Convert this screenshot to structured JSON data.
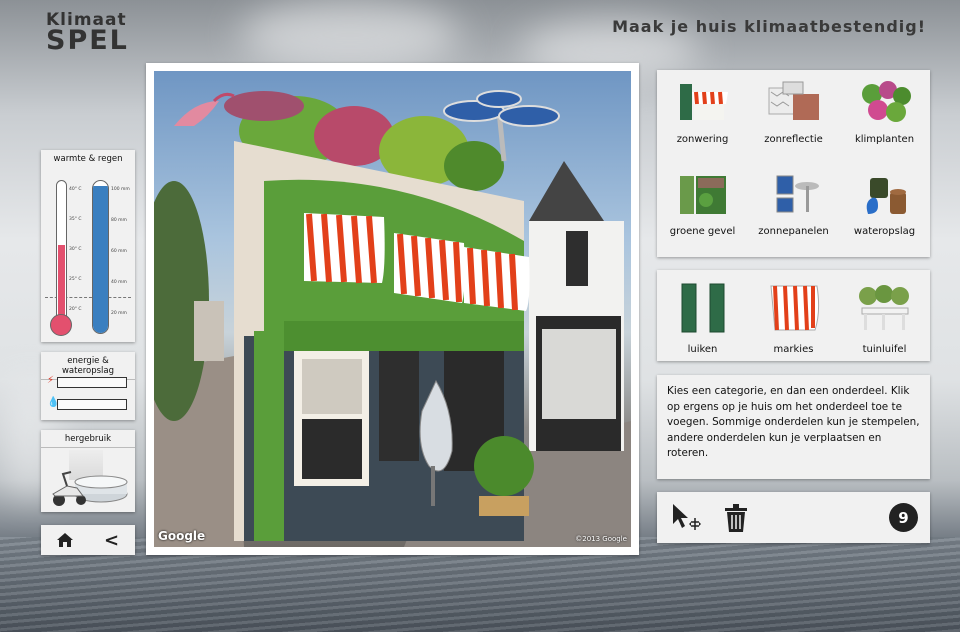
{
  "logo": {
    "line1": "Klimaat",
    "line2": "SPEL"
  },
  "headline": "Maak je huis klimaatbestendig!",
  "weather": {
    "title": "warmte & regen",
    "temp_ticks": [
      "40° C",
      "35° C",
      "30° C",
      "25° C",
      "20° C"
    ],
    "rain_ticks": [
      "100 mm",
      "80 mm",
      "60 mm",
      "40 mm",
      "20 mm"
    ],
    "temp_level": 0.55,
    "rain_level": 0.97
  },
  "energy": {
    "title": "energie & wateropslag",
    "energy_level": 0,
    "water_level": 0
  },
  "reuse": {
    "title": "hergebruik"
  },
  "nav": {
    "home_icon": "home-icon",
    "back_icon": "back-chevron-icon",
    "back_glyph": "<"
  },
  "viewport": {
    "watermark_left": "Google",
    "watermark_right": "©2013 Google"
  },
  "categories": [
    {
      "label": "zonwering",
      "icon": "awning-shade-icon"
    },
    {
      "label": "zonreflectie",
      "icon": "sun-reflection-icon"
    },
    {
      "label": "klimplanten",
      "icon": "climbing-plants-icon"
    },
    {
      "label": "groene gevel",
      "icon": "green-facade-icon"
    },
    {
      "label": "zonnepanelen",
      "icon": "solar-panels-icon"
    },
    {
      "label": "wateropslag",
      "icon": "water-storage-icon"
    }
  ],
  "parts": [
    {
      "label": "luiken",
      "icon": "shutters-icon"
    },
    {
      "label": "markies",
      "icon": "marquee-awning-icon"
    },
    {
      "label": "tuinluifel",
      "icon": "garden-canopy-icon"
    }
  ],
  "help_text": "Kies een categorie, en dan een onderdeel. Klik op ergens op je huis om het onderdeel toe te voegen. Sommige onderdelen kun je stempelen, andere onderdelen kun je verplaatsen en roteren.",
  "tools": {
    "move_icon": "move-cursor-icon",
    "delete_icon": "trash-icon",
    "count": "9"
  },
  "colors": {
    "panel": "#f1f1f1",
    "thermo_red": "#e3506e",
    "rain_blue": "#3a7fc0",
    "awning_red": "#e2401a"
  }
}
